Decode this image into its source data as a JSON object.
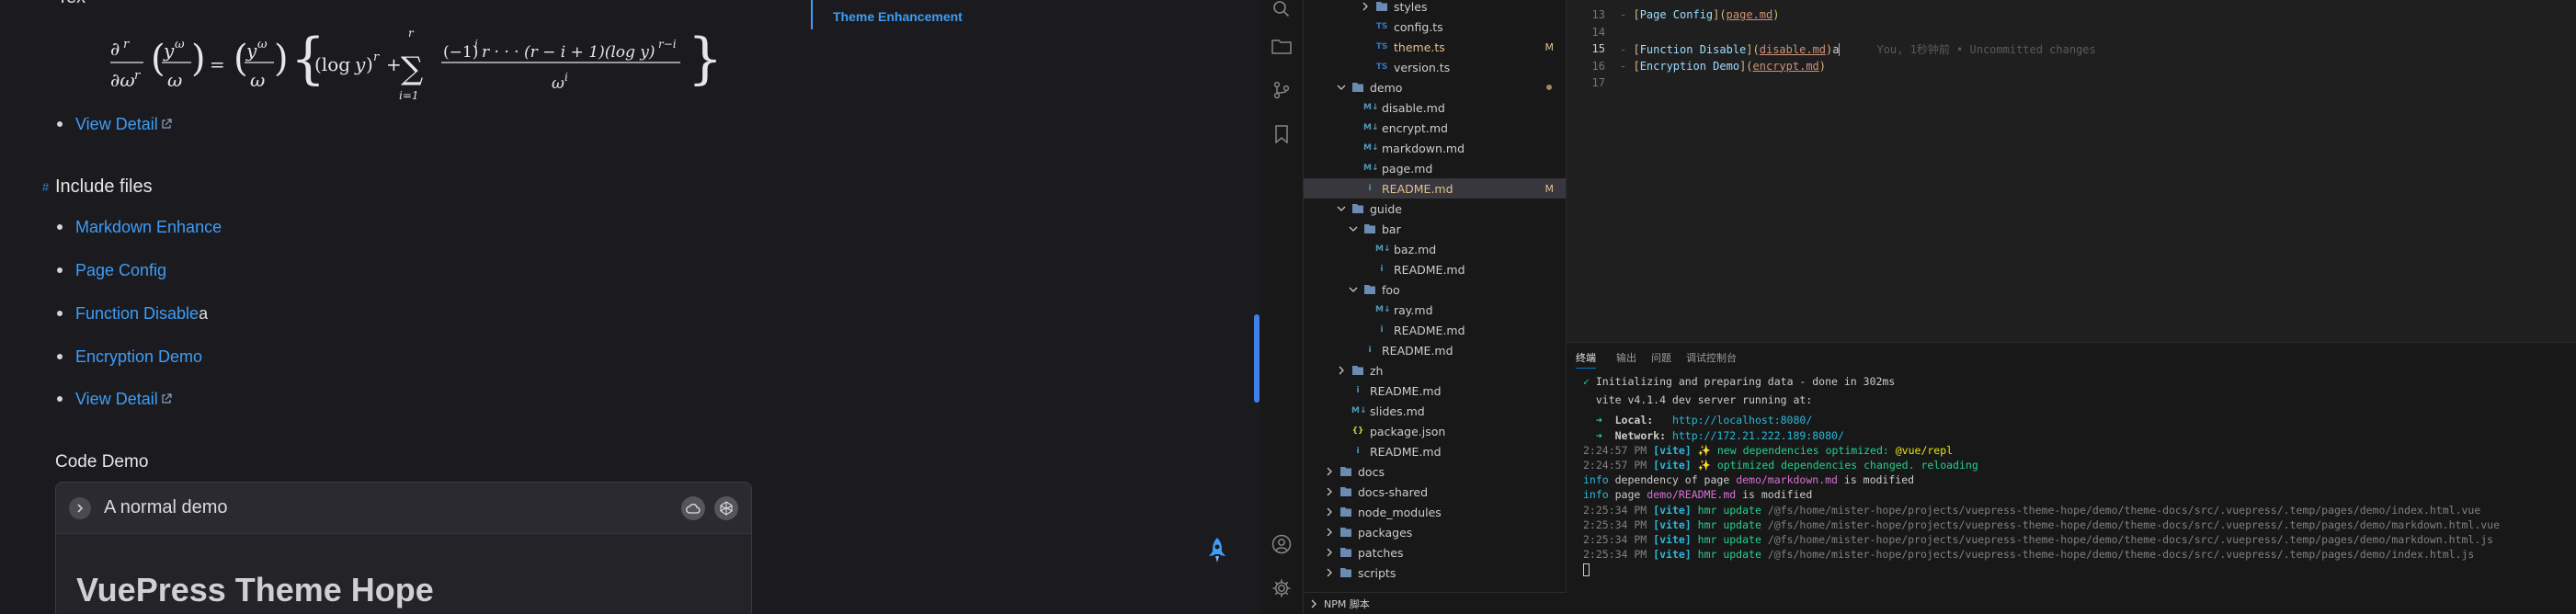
{
  "doc": {
    "tex_label": "Tex",
    "toc_item": "Theme Enhancement",
    "links_top": [
      {
        "label": "View Detail"
      }
    ],
    "include_heading": "Include files",
    "include_items": [
      {
        "label": "Markdown Enhance",
        "suffix": "",
        "external": false
      },
      {
        "label": "Page Config",
        "suffix": "",
        "external": false
      },
      {
        "label": "Function Disable",
        "suffix": "a",
        "external": false
      },
      {
        "label": "Encryption Demo",
        "suffix": "",
        "external": false
      },
      {
        "label": "View Detail",
        "suffix": "",
        "external": true
      }
    ],
    "code_demo_heading": "Code Demo",
    "demo_title": "A normal demo",
    "demo_body_title": "VuePress Theme Hope"
  },
  "explorer": {
    "items": [
      {
        "label": "styles",
        "kind": "folder",
        "level": 4,
        "open": false,
        "badge": ""
      },
      {
        "label": "config.ts",
        "kind": "ts",
        "level": 4,
        "badge": ""
      },
      {
        "label": "theme.ts",
        "kind": "ts",
        "level": 4,
        "badge": "M"
      },
      {
        "label": "version.ts",
        "kind": "ts",
        "level": 4,
        "badge": ""
      },
      {
        "label": "demo",
        "kind": "folder",
        "level": 2,
        "open": true,
        "badge": "dot"
      },
      {
        "label": "disable.md",
        "kind": "md",
        "level": 3,
        "badge": ""
      },
      {
        "label": "encrypt.md",
        "kind": "md",
        "level": 3,
        "badge": ""
      },
      {
        "label": "markdown.md",
        "kind": "md",
        "level": 3,
        "badge": ""
      },
      {
        "label": "page.md",
        "kind": "md",
        "level": 3,
        "badge": ""
      },
      {
        "label": "README.md",
        "kind": "info",
        "level": 3,
        "badge": "M",
        "active": true
      },
      {
        "label": "guide",
        "kind": "folder",
        "level": 2,
        "open": true,
        "badge": ""
      },
      {
        "label": "bar",
        "kind": "folder",
        "level": 3,
        "open": true,
        "badge": ""
      },
      {
        "label": "baz.md",
        "kind": "md",
        "level": 4,
        "badge": ""
      },
      {
        "label": "README.md",
        "kind": "info",
        "level": 4,
        "badge": ""
      },
      {
        "label": "foo",
        "kind": "folder",
        "level": 3,
        "open": true,
        "badge": ""
      },
      {
        "label": "ray.md",
        "kind": "md",
        "level": 4,
        "badge": ""
      },
      {
        "label": "README.md",
        "kind": "info",
        "level": 4,
        "badge": ""
      },
      {
        "label": "README.md",
        "kind": "info",
        "level": 3,
        "badge": ""
      },
      {
        "label": "zh",
        "kind": "folder",
        "level": 2,
        "open": false,
        "badge": ""
      },
      {
        "label": "README.md",
        "kind": "info",
        "level": 2,
        "badge": ""
      },
      {
        "label": "slides.md",
        "kind": "md",
        "level": 2,
        "badge": ""
      },
      {
        "label": "package.json",
        "kind": "json",
        "level": 2,
        "badge": ""
      },
      {
        "label": "README.md",
        "kind": "info",
        "level": 2,
        "badge": ""
      },
      {
        "label": "docs",
        "kind": "folder",
        "level": 1,
        "open": false,
        "badge": ""
      },
      {
        "label": "docs-shared",
        "kind": "folder",
        "level": 1,
        "open": false,
        "badge": ""
      },
      {
        "label": "node_modules",
        "kind": "folder",
        "level": 1,
        "open": false,
        "badge": ""
      },
      {
        "label": "packages",
        "kind": "folder",
        "level": 1,
        "open": false,
        "badge": ""
      },
      {
        "label": "patches",
        "kind": "folder",
        "level": 1,
        "open": false,
        "badge": ""
      },
      {
        "label": "scripts",
        "kind": "folder",
        "level": 1,
        "open": false,
        "badge": ""
      }
    ],
    "npm_label": "NPM 脚本"
  },
  "editor": {
    "lines": [
      {
        "no": "13",
        "bullet": "- ",
        "text": "Page Config",
        "url": "page.md",
        "suffix": "",
        "blame": ""
      },
      {
        "no": "14",
        "bullet": "",
        "text": "",
        "url": "",
        "suffix": "",
        "blame": ""
      },
      {
        "no": "15",
        "bullet": "- ",
        "text": "Function Disable",
        "url": "disable.md",
        "suffix": "a",
        "blame": "You, 1秒钟前 • Uncommitted changes",
        "current": true
      },
      {
        "no": "16",
        "bullet": "- ",
        "text": "Encryption Demo",
        "url": "encrypt.md",
        "suffix": "",
        "blame": ""
      },
      {
        "no": "17",
        "bullet": "",
        "text": "",
        "url": "",
        "suffix": "",
        "blame": ""
      }
    ]
  },
  "panel": {
    "tabs": [
      "终端",
      "输出",
      "问题",
      "调试控制台"
    ],
    "active_tab": "终端",
    "ready": "Initializing and preparing data - done in 302ms",
    "vite_banner": "vite v4.1.4 dev server running at:",
    "local_label": "Local:",
    "local_url": "http://localhost:8080/",
    "network_label": "Network:",
    "network_url": "http://172.21.222.189:8080/",
    "log": [
      {
        "time": "2:24:57 PM",
        "tag": "[vite]",
        "msg": "✨ new dependencies optimized:",
        "extra": "@vue/repl"
      },
      {
        "time": "2:24:57 PM",
        "tag": "[vite]",
        "msg": "✨ optimized dependencies changed. reloading",
        "extra": ""
      },
      {
        "time": "",
        "tag": "info",
        "msg": "dependency of page",
        "extra": "demo/markdown.md",
        "tail": "is modified"
      },
      {
        "time": "",
        "tag": "info",
        "msg": "page",
        "extra": "demo/README.md",
        "tail": "is modified"
      },
      {
        "time": "2:25:34 PM",
        "tag": "[vite]",
        "msg": "hmr update",
        "extra": "/@fs/home/mister-hope/projects/vuepress-theme-hope/demo/theme-docs/src/.vuepress/.temp/pages/demo/index.html.vue"
      },
      {
        "time": "2:25:34 PM",
        "tag": "[vite]",
        "msg": "hmr update",
        "extra": "/@fs/home/mister-hope/projects/vuepress-theme-hope/demo/theme-docs/src/.vuepress/.temp/pages/demo/markdown.html.vue"
      },
      {
        "time": "2:25:34 PM",
        "tag": "[vite]",
        "msg": "hmr update",
        "extra": "/@fs/home/mister-hope/projects/vuepress-theme-hope/demo/theme-docs/src/.vuepress/.temp/pages/demo/markdown.html.js"
      },
      {
        "time": "2:25:34 PM",
        "tag": "[vite]",
        "msg": "hmr update",
        "extra": "/@fs/home/mister-hope/projects/vuepress-theme-hope/demo/theme-docs/src/.vuepress/.temp/pages/demo/index.html.js"
      }
    ]
  }
}
